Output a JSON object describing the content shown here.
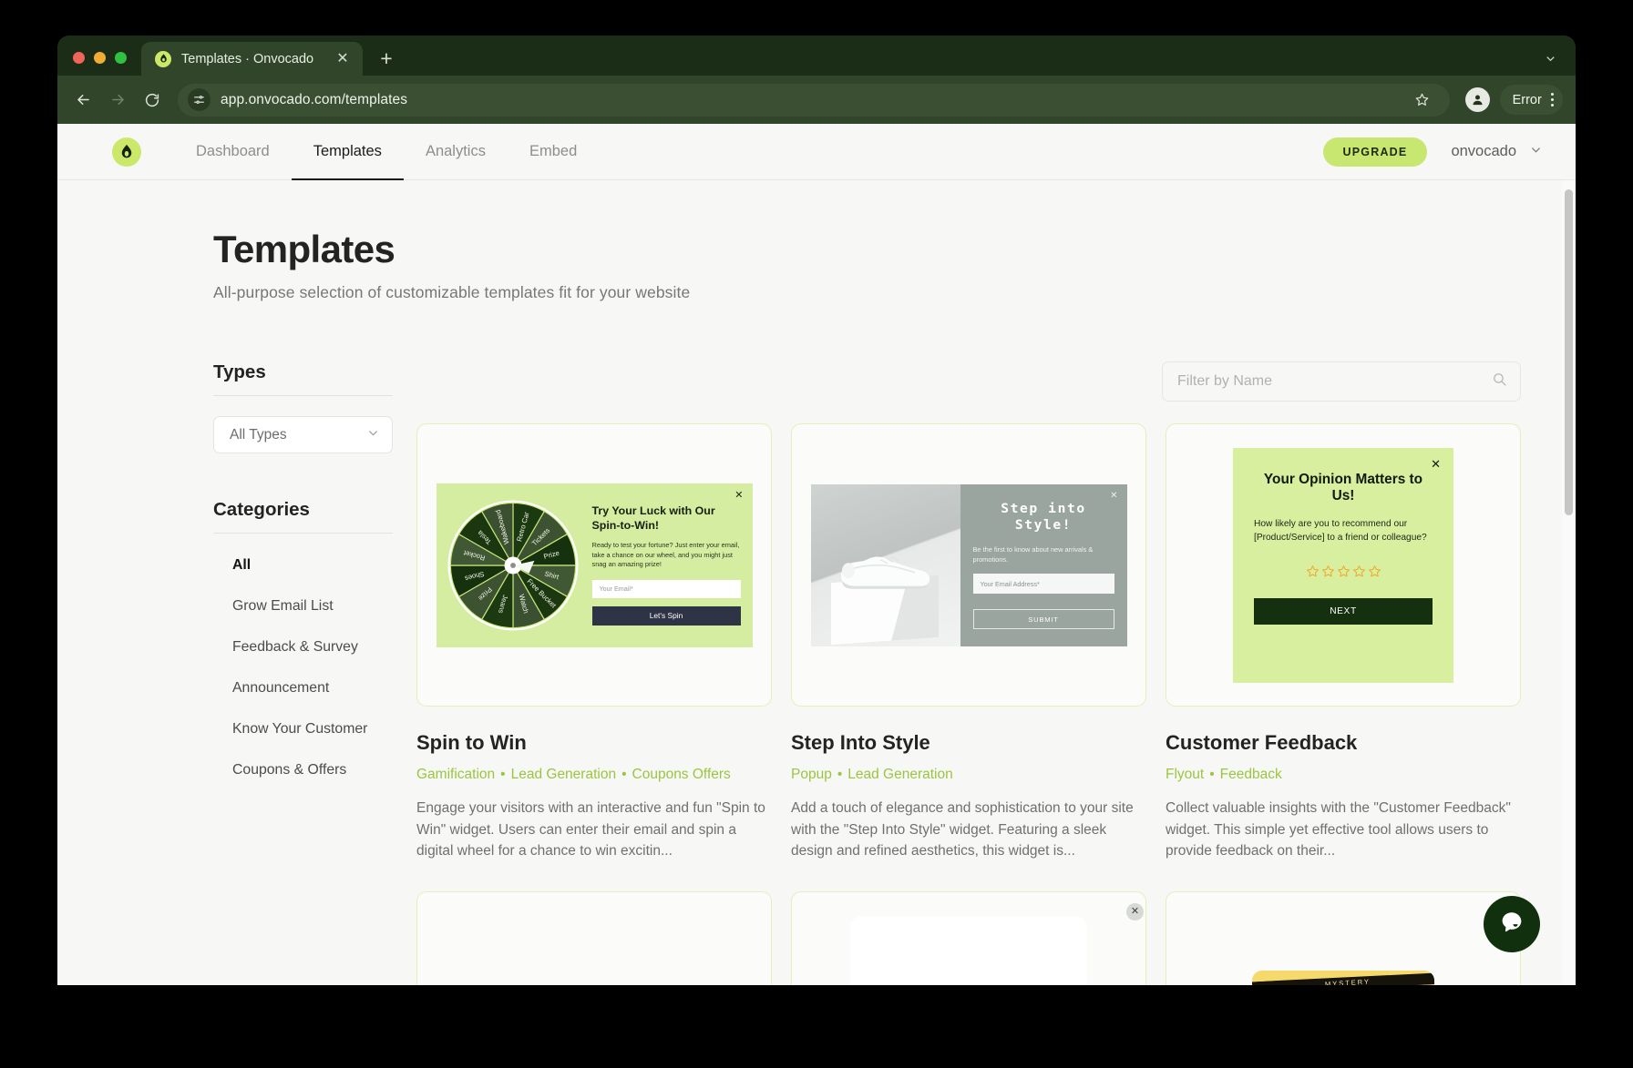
{
  "browser": {
    "tab": {
      "title": "Templates · Onvocado",
      "favicon_icon": "avocado-droplet-icon",
      "close_icon": "close-icon"
    },
    "new_tab_icon": "plus-icon",
    "tab_list_icon": "chevron-down-icon",
    "back_icon": "arrow-left-icon",
    "forward_icon": "arrow-right-icon",
    "reload_icon": "reload-icon",
    "site_info_icon": "tune-icon",
    "url": "app.onvocado.com/templates",
    "bookmark_icon": "star-icon",
    "profile_icon": "person-icon",
    "error_label": "Error",
    "menu_icon": "kebab-menu-icon",
    "colors": {
      "chrome": "#1c2d17",
      "toolbar": "#31452a",
      "tab_active": "#31452a"
    }
  },
  "app_header": {
    "logo_icon": "onvocado-logo-icon",
    "nav": [
      {
        "label": "Dashboard",
        "active": false
      },
      {
        "label": "Templates",
        "active": true
      },
      {
        "label": "Analytics",
        "active": false
      },
      {
        "label": "Embed",
        "active": false
      }
    ],
    "upgrade_label": "UPGRADE",
    "account_name": "onvocado",
    "account_chevron_icon": "chevron-down-icon",
    "accent_color": "#c7e770"
  },
  "page": {
    "title": "Templates",
    "subtitle": "All-purpose selection of customizable templates fit for your website"
  },
  "filters": {
    "types_heading": "Types",
    "type_select_value": "All Types",
    "type_select_icon": "chevron-down-icon",
    "categories_heading": "Categories",
    "categories": [
      {
        "label": "All",
        "active": true
      },
      {
        "label": "Grow Email List",
        "active": false
      },
      {
        "label": "Feedback & Survey",
        "active": false
      },
      {
        "label": "Announcement",
        "active": false
      },
      {
        "label": "Know Your Customer",
        "active": false
      },
      {
        "label": "Coupons & Offers",
        "active": false
      }
    ]
  },
  "search": {
    "placeholder": "Filter by Name",
    "value": "",
    "icon": "search-icon"
  },
  "templates": [
    {
      "title": "Spin to Win",
      "tags": [
        "Gamification",
        "Lead Generation",
        "Coupons Offers"
      ],
      "description": "Engage your visitors with an interactive and fun \"Spin to Win\" widget. Users can enter their email and spin a digital wheel for a chance to win excitin...",
      "preview": {
        "kind": "spin-to-win",
        "heading": "Try Your Luck with Our Spin-to-Win!",
        "body": "Ready to test your fortune? Just enter your email, take a chance on our wheel, and you might just snag an amazing prize!",
        "input_placeholder": "Your Email*",
        "button_label": "Let's Spin",
        "close_icon": "close-icon",
        "wheel_segments": [
          "Retro Car",
          "Tickets",
          "Prize",
          "Shirt",
          "Free Bucket",
          "Watch",
          "Jeans",
          "Prize",
          "Shoes",
          "Rocket",
          "Tesla",
          "Wakeboard"
        ],
        "bg_color": "#d4eda0",
        "button_color": "#2e3345"
      }
    },
    {
      "title": "Step Into Style",
      "tags": [
        "Popup",
        "Lead Generation"
      ],
      "description": "Add a touch of elegance and sophistication to your site with the \"Step Into Style\" widget. Featuring a sleek design and refined aesthetics, this widget is...",
      "preview": {
        "kind": "step-into-style",
        "heading": "Step into Style!",
        "body": "Be the first to know about new arrivals & promotions.",
        "input_placeholder": "Your Email Address*",
        "button_label": "SUBMIT",
        "close_icon": "close-icon",
        "image_alt": "white-sneaker-on-pedestal",
        "bg_color": "#9aa5a0"
      }
    },
    {
      "title": "Customer Feedback",
      "tags": [
        "Flyout",
        "Feedback"
      ],
      "description": "Collect valuable insights with the \"Customer Feedback\" widget. This simple yet effective tool allows users to provide feedback on their...",
      "preview": {
        "kind": "customer-feedback",
        "heading": "Your Opinion Matters to Us!",
        "body": "How likely are you to recommend our [Product/Service] to a friend or colleague?",
        "stars": 5,
        "stars_filled": 0,
        "star_color": "#f0a92a",
        "button_label": "NEXT",
        "close_icon": "close-icon",
        "bg_color": "#d7ef9f",
        "button_color": "#15300f"
      }
    }
  ],
  "templates_row2": [
    {
      "preview": {
        "kind": "blank"
      }
    },
    {
      "preview": {
        "kind": "white-card",
        "close_icon": "close-circle-icon"
      }
    },
    {
      "preview": {
        "kind": "yellow-ticket",
        "ribbon_label": "MYSTERY"
      }
    }
  ],
  "chat": {
    "icon": "chat-bubble-icon",
    "color": "#11300e"
  },
  "scrollbar": {
    "orientation": "vertical"
  }
}
